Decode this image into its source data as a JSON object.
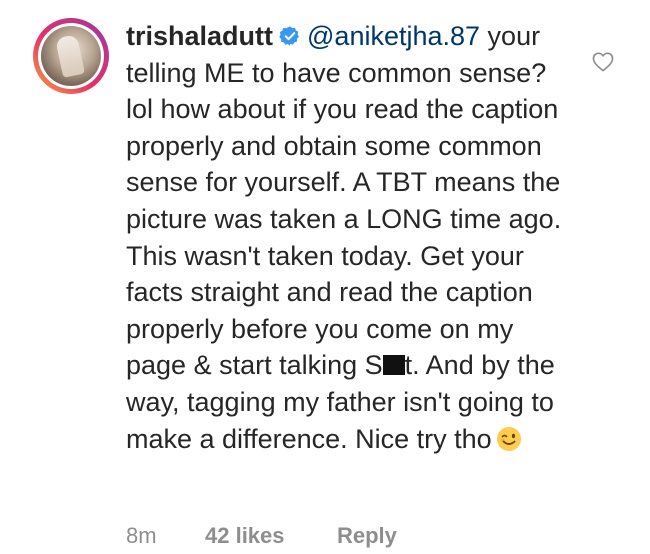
{
  "comment": {
    "username": "trishaladutt",
    "mention": "@aniketjha.87",
    "body_part1": " your telling ME to have common sense? lol how about if you read the caption properly and obtain some common sense for yourself. A TBT means the picture was taken a LONG time ago. This wasn't taken today. Get your facts straight and read the caption properly before you come on my page & start talking S",
    "body_part2": "t. And by the way, tagging my father isn't going to make a difference. Nice try tho",
    "icons": {
      "verified": "verified-badge-icon",
      "emoji": "winking-smile-emoji-icon",
      "like": "heart-outline-icon"
    },
    "meta": {
      "time": "8m",
      "likes": "42 likes",
      "reply": "Reply"
    },
    "colors": {
      "text": "#262626",
      "mention": "#00376b",
      "meta": "#8e8e8e",
      "verified": "#3897f0"
    }
  }
}
